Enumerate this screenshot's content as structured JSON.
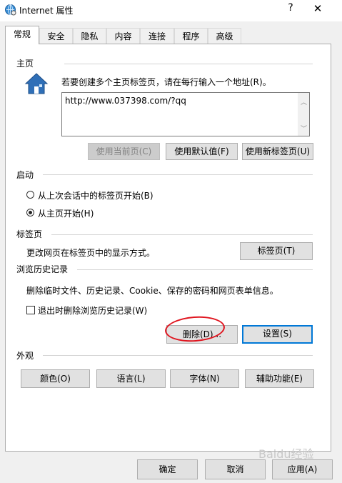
{
  "window": {
    "title": "Internet 属性",
    "help": "?",
    "close": "✕"
  },
  "tabs": [
    "常规",
    "安全",
    "隐私",
    "内容",
    "连接",
    "程序",
    "高级"
  ],
  "homepage": {
    "section": "主页",
    "hint": "若要创建多个主页标签页，请在每行输入一个地址(R)。",
    "value": "http://www.037398.com/?qq",
    "buttons": {
      "use_current": "使用当前页(C)",
      "use_default": "使用默认值(F)",
      "use_new_tab": "使用新标签页(U)"
    }
  },
  "startup": {
    "section": "启动",
    "option_last_session": "从上次会话中的标签页开始(B)",
    "option_homepage": "从主页开始(H)",
    "selected": "homepage"
  },
  "tabs_section": {
    "section": "标签页",
    "desc": "更改网页在标签页中的显示方式。",
    "button": "标签页(T)"
  },
  "history": {
    "section": "浏览历史记录",
    "desc": "删除临时文件、历史记录、Cookie、保存的密码和网页表单信息。",
    "checkbox": "退出时删除浏览历史记录(W)",
    "delete": "删除(D)...",
    "settings": "设置(S)"
  },
  "appearance": {
    "section": "外观",
    "colors": "颜色(O)",
    "languages": "语言(L)",
    "fonts": "字体(N)",
    "accessibility": "辅助功能(E)"
  },
  "footer": {
    "ok": "确定",
    "cancel": "取消",
    "apply": "应用(A)"
  },
  "watermark": "Baidu经验"
}
